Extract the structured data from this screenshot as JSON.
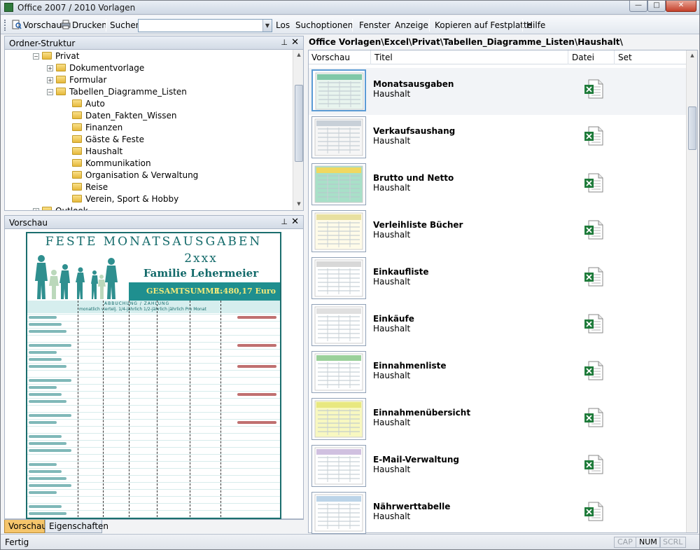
{
  "window": {
    "title": "Office 2007 / 2010 Vorlagen",
    "minimize": "—",
    "maximize": "□",
    "close": "✕"
  },
  "toolbar": {
    "preview": "Vorschau",
    "print": "Drucken",
    "search_label": "Suchen",
    "search_value": "",
    "go": "Los",
    "search_options": "Suchoptionen",
    "window": "Fenster",
    "view": "Anzeige",
    "copy": "Kopieren auf Festplatte",
    "help": "Hilfe"
  },
  "folder_pane": {
    "title": "Ordner-Struktur",
    "pin": "⊥",
    "close": "✕",
    "tree": [
      {
        "label": "Privat",
        "level": 0,
        "expander": "−"
      },
      {
        "label": "Dokumentvorlage",
        "level": 1,
        "expander": "+"
      },
      {
        "label": "Formular",
        "level": 1,
        "expander": "+"
      },
      {
        "label": "Tabellen_Diagramme_Listen",
        "level": 1,
        "expander": "−"
      },
      {
        "label": "Auto",
        "level": 2
      },
      {
        "label": "Daten_Fakten_Wissen",
        "level": 2
      },
      {
        "label": "Finanzen",
        "level": 2
      },
      {
        "label": "Gäste & Feste",
        "level": 2
      },
      {
        "label": "Haushalt",
        "level": 2
      },
      {
        "label": "Kommunikation",
        "level": 2
      },
      {
        "label": "Organisation & Verwaltung",
        "level": 2
      },
      {
        "label": "Reise",
        "level": 2
      },
      {
        "label": "Verein, Sport & Hobby",
        "level": 2
      },
      {
        "label": "Outlook",
        "level": 0,
        "expander": "+"
      }
    ]
  },
  "preview_pane": {
    "title": "Vorschau",
    "pin": "⊥",
    "close": "✕",
    "sheet": {
      "title": "FESTE MONATSAUSGABEN",
      "subtitle": "2xxx",
      "family": "Familie Lehermeier",
      "total_label": "GESAMTSUMME:",
      "total_value": "1.480,17 Euro",
      "band_title": "ABBUCHUNG / ZAHLUNG",
      "band_cols": "monatlich  viertelj.  1/4-jährlich  1/2-jährlich  jährlich      Pro Monat",
      "rows": []
    }
  },
  "bottom_tabs": [
    "Vorschau",
    "Eigenschaften"
  ],
  "path": "Office Vorlagen\\Excel\\Privat\\Tabellen_Diagramme_Listen\\Haushalt\\",
  "columns": [
    "Vorschau",
    "Titel",
    "Datei",
    "Set"
  ],
  "items": [
    {
      "title": "Monatsausgaben",
      "category": "Haushalt",
      "selected": true
    },
    {
      "title": "Verkaufsaushang",
      "category": "Haushalt"
    },
    {
      "title": "Brutto und Netto",
      "category": "Haushalt"
    },
    {
      "title": "Verleihliste Bücher",
      "category": "Haushalt"
    },
    {
      "title": "Einkaufliste",
      "category": "Haushalt"
    },
    {
      "title": "Einkäufe",
      "category": "Haushalt"
    },
    {
      "title": "Einnahmenliste",
      "category": "Haushalt"
    },
    {
      "title": "Einnahmenübersicht",
      "category": "Haushalt"
    },
    {
      "title": "E-Mail-Verwaltung",
      "category": "Haushalt"
    },
    {
      "title": "Nährwerttabelle",
      "category": "Haushalt"
    }
  ],
  "status": {
    "text": "Fertig",
    "cap": "CAP",
    "num": "NUM",
    "scrl": "SCRL"
  },
  "colors": {
    "accent_teal": "#1f8f8f",
    "tab_active": "#f5c56b",
    "selection": "#5b9bd5"
  }
}
